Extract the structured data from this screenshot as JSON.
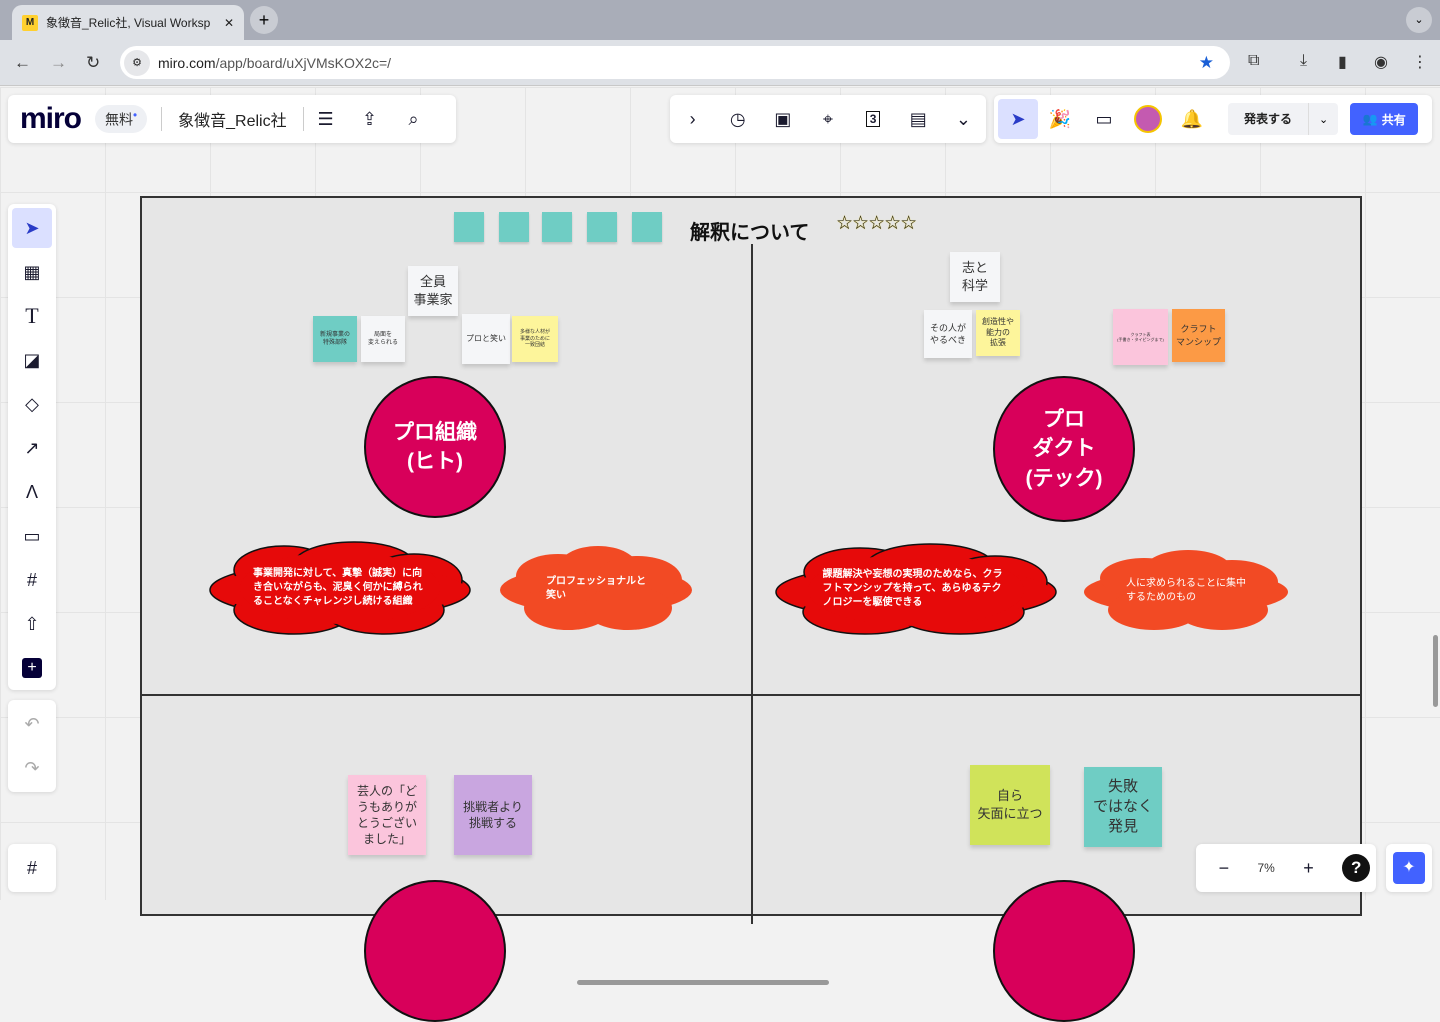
{
  "browser": {
    "tab_title": "象徴音_Relic社, Visual Worksp",
    "tab_favicon": "miro-icon",
    "url_domain": "miro.com",
    "url_path": "/app/board/uXjVMsKOX2c=/"
  },
  "toolbar": {
    "logo": "miro",
    "plan_badge": "無料",
    "board_name": "象徴音_Relic社",
    "present_label": "発表する",
    "share_label": "共有",
    "page_count": "3"
  },
  "zoom": {
    "level": "7%",
    "help": "?"
  },
  "board": {
    "title": "解釈について",
    "rating": "☆☆☆☆☆",
    "q1": {
      "label_sticky": "全員\n事業家",
      "stickies": [
        "新規事業の\n特殊部隊",
        "局面を\n変えられる",
        "プロと笑い",
        "多様な人材が\n事業のために\n一致団結"
      ],
      "circle": "プロ組織\n(ヒト)",
      "cloud1": "事業開発に対して、真摯（誠実）に向き合いながらも、泥臭く何かに縛られることなくチャレンジし続ける組織",
      "cloud2": "プロフェッショナルと\n笑い"
    },
    "q2": {
      "label_sticky": "志と\n科学",
      "stickies": [
        "その人が\nやるべき",
        "創造性や\n能力の\n拡張",
        "クラフト表\n(手書き・タイピングまで)",
        "クラフト\nマンシップ"
      ],
      "circle": "プロ\nダクト\n(テック)",
      "cloud1": "課題解決や妄想の実現のためなら、クラフトマンシップを持って、あらゆるテクノロジーを駆使できる",
      "cloud2": "人に求められることに集中\nするためのもの"
    },
    "q3": {
      "stickies": [
        "芸人の「ど\nうもありが\nとうござい\nました」",
        "挑戦者より\n挑戦する"
      ]
    },
    "q4": {
      "stickies": [
        "自ら\n矢面に立つ",
        "失敗\nではなく\n発見"
      ]
    }
  },
  "colors": {
    "accent": "#4262ff",
    "circle": "#d8005a",
    "cloud_red": "#e60a0a",
    "cloud_orange": "#f24a24"
  }
}
